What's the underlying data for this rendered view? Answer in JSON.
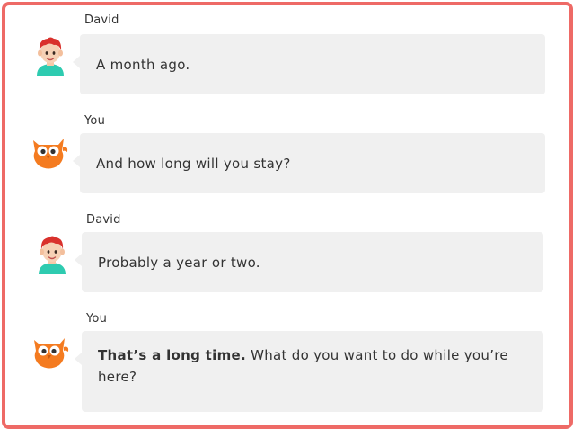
{
  "conversation": {
    "messages": [
      {
        "speaker": "David",
        "avatar": "boy-avatar-icon",
        "text": "A month ago."
      },
      {
        "speaker": "You",
        "avatar": "owl-avatar-icon",
        "text": "And how long will you stay?"
      },
      {
        "speaker": "David",
        "avatar": "boy-avatar-icon",
        "text": "Probably a year or two."
      },
      {
        "speaker": "You",
        "avatar": "owl-avatar-icon",
        "bold_text": "That’s a long time.",
        "text": " What do you want to do while you’re here?"
      }
    ]
  },
  "colors": {
    "frame_border": "#ee6a66",
    "bubble_bg": "#f0f0f0",
    "text": "#333333",
    "owl": "#f47b20",
    "boy_hair": "#d9312c",
    "boy_shirt": "#2ecbb0"
  }
}
